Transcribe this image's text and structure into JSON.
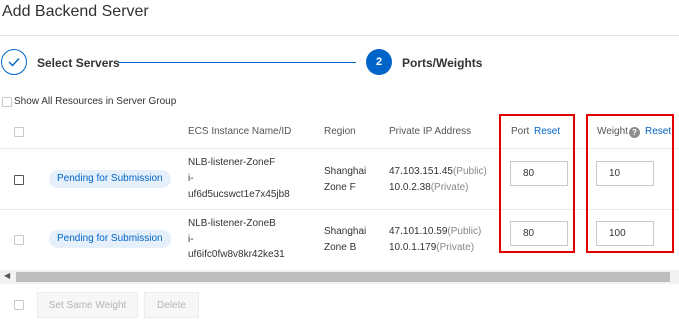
{
  "dialog": {
    "title": "Add Backend Server"
  },
  "steps": [
    {
      "label": "Select Servers",
      "state": "done"
    },
    {
      "number": "2",
      "label": "Ports/Weights",
      "state": "active"
    }
  ],
  "show_all": {
    "label": "Show All Resources in Server Group"
  },
  "table": {
    "headers": {
      "instance": "ECS Instance Name/ID",
      "region": "Region",
      "ip": "Private IP Address",
      "port": "Port",
      "port_reset": "Reset",
      "weight": "Weight",
      "weight_reset": "Reset"
    },
    "rows": [
      {
        "status": "Pending for Submission",
        "name": "NLB-listener-ZoneF",
        "id_line1": "i-",
        "id_line2": "uf6d5ucswct1e7x45jb8",
        "region_line1": "Shanghai",
        "region_line2": "Zone F",
        "public_ip": "47.103.151.45",
        "public_tag": "(Public)",
        "private_ip": "10.0.2.38",
        "private_tag": "(Private)",
        "port": "80",
        "weight": "10"
      },
      {
        "status": "Pending for Submission",
        "name": "NLB-listener-ZoneB",
        "id_line1": "i-",
        "id_line2": "uf6ifc0fw8v8kr42ke31",
        "region_line1": "Shanghai",
        "region_line2": "Zone B",
        "public_ip": "47.101.10.59",
        "public_tag": "(Public)",
        "private_ip": "10.0.1.179",
        "private_tag": "(Private)",
        "port": "80",
        "weight": "100"
      }
    ]
  },
  "footer": {
    "set_same_weight": "Set Same Weight",
    "delete": "Delete"
  },
  "colors": {
    "accent": "#0064c8",
    "highlight": "#e00000"
  }
}
